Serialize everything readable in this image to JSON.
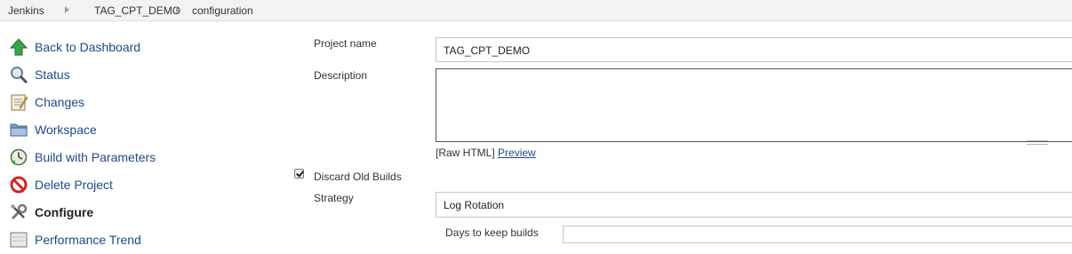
{
  "breadcrumb": {
    "items": [
      "Jenkins",
      "TAG_CPT_DEMO",
      "configuration"
    ]
  },
  "sidebar": {
    "items": [
      {
        "label": "Back to Dashboard",
        "icon": "up-arrow-icon"
      },
      {
        "label": "Status",
        "icon": "search-icon"
      },
      {
        "label": "Changes",
        "icon": "notepad-icon"
      },
      {
        "label": "Workspace",
        "icon": "folder-icon"
      },
      {
        "label": "Build with Parameters",
        "icon": "clock-icon"
      },
      {
        "label": "Delete Project",
        "icon": "no-entry-icon"
      },
      {
        "label": "Configure",
        "icon": "wrench-icon"
      },
      {
        "label": "Performance Trend",
        "icon": "graph-icon"
      }
    ]
  },
  "form": {
    "project_name_label": "Project name",
    "project_name_value": "TAG_CPT_DEMO",
    "description_label": "Description",
    "description_value": "",
    "raw_html_text": "[Raw HTML]",
    "preview_link": "Preview",
    "discard_old_builds_label": "Discard Old Builds",
    "discard_old_builds_checked": true,
    "strategy_label": "Strategy",
    "strategy_value": "Log Rotation",
    "days_to_keep_label": "Days to keep builds"
  },
  "colors": {
    "link": "#204a87",
    "breadcrumb_bg": "#f2f2f2"
  }
}
